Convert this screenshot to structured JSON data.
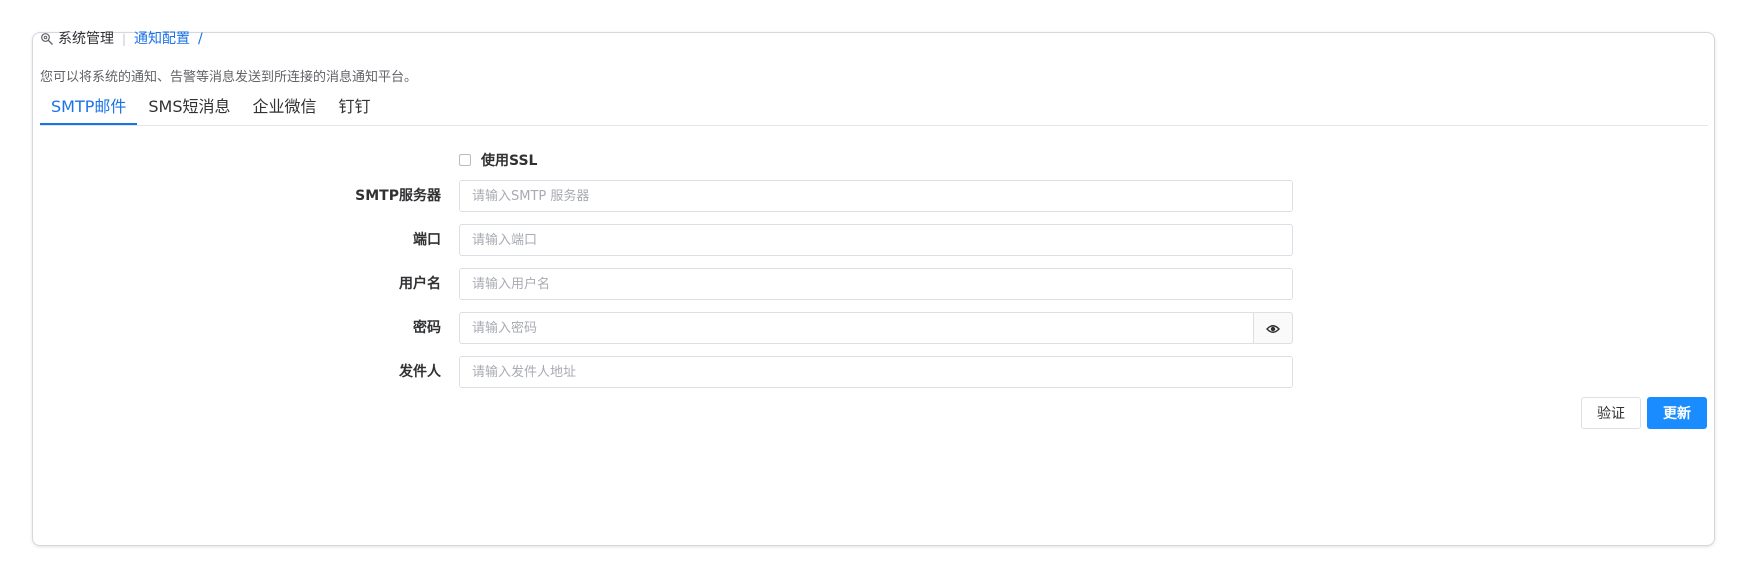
{
  "breadcrumb": {
    "root": "系统管理",
    "current": "通知配置",
    "trailing": "/"
  },
  "description": "您可以将系统的通知、告警等消息发送到所连接的消息通知平台。",
  "tabs": [
    {
      "label": "SMTP邮件",
      "active": true
    },
    {
      "label": "SMS短消息",
      "active": false
    },
    {
      "label": "企业微信",
      "active": false
    },
    {
      "label": "钉钉",
      "active": false
    }
  ],
  "form": {
    "ssl": {
      "label": "使用SSL",
      "checked": false
    },
    "server": {
      "label": "SMTP服务器",
      "placeholder": "请输入SMTP 服务器",
      "value": ""
    },
    "port": {
      "label": "端口",
      "placeholder": "请输入端口",
      "value": ""
    },
    "username": {
      "label": "用户名",
      "placeholder": "请输入用户名",
      "value": ""
    },
    "password": {
      "label": "密码",
      "placeholder": "请输入密码",
      "value": ""
    },
    "sender": {
      "label": "发件人",
      "placeholder": "请输入发件人地址",
      "value": ""
    }
  },
  "actions": {
    "verify": "验证",
    "update": "更新"
  },
  "colors": {
    "accent": "#1a73e8",
    "primary_button": "#1a8cff",
    "border": "#dcdfe6"
  },
  "icons": {
    "breadcrumb": "settings-search-icon",
    "password_toggle": "eye-icon"
  }
}
